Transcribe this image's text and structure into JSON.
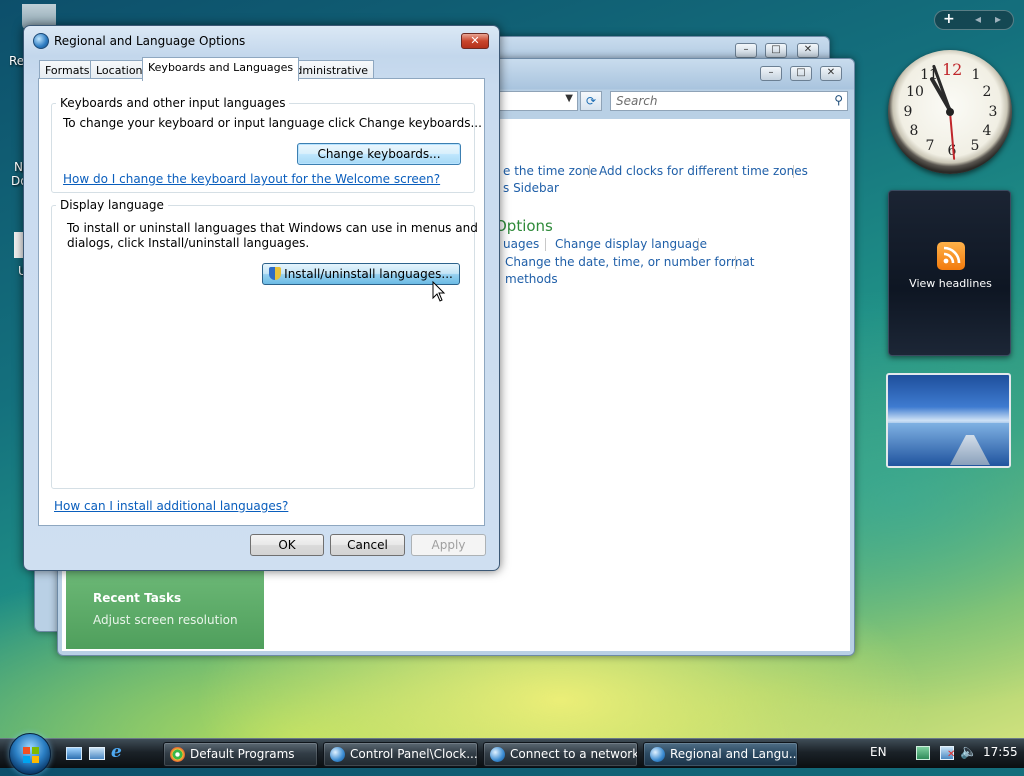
{
  "desktop": {
    "icon_fragments": [
      "Re",
      "N",
      "Do",
      "U"
    ]
  },
  "sidebar": {
    "add_symbol": "+",
    "prev_symbol": "◂",
    "next_symbol": "▸"
  },
  "clock": {
    "numerals": [
      "12",
      "1",
      "2",
      "3",
      "4",
      "5",
      "6",
      "7",
      "8",
      "9",
      "10",
      "11"
    ]
  },
  "feed_gadget": {
    "label": "View headlines"
  },
  "control_panel": {
    "search_placeholder": "Search",
    "links_row1": [
      "e the time zone",
      "Add clocks for different time zones"
    ],
    "link_row2": "s Sidebar",
    "section_heading": "Options",
    "links_row3": [
      "uages",
      "Change display language"
    ],
    "link_row4": "Change the date, time, or number format",
    "link_row5": "methods",
    "recent_tasks_title": "Recent Tasks",
    "recent_tasks_item": "Adjust screen resolution"
  },
  "dialog": {
    "title": "Regional and Language Options",
    "tabs": [
      "Formats",
      "Location",
      "Keyboards and Languages",
      "Administrative"
    ],
    "active_tab": "Keyboards and Languages",
    "keyboards_group": {
      "title": "Keyboards and other input languages",
      "description": "To change your keyboard or input language click Change keyboards...",
      "button": "Change keyboards...",
      "link": "How do I change the keyboard layout for the Welcome screen?"
    },
    "display_group": {
      "title": "Display language",
      "description_line1": "To install or uninstall languages that Windows can use in menus and",
      "description_line2": "dialogs, click Install/uninstall languages.",
      "button": "Install/uninstall languages..."
    },
    "footer_link": "How can I install additional languages?",
    "buttons": {
      "ok": "OK",
      "cancel": "Cancel",
      "apply": "Apply"
    }
  },
  "taskbar": {
    "buttons": [
      {
        "label": "Default Programs",
        "icon": "default-programs-icon"
      },
      {
        "label": "Control Panel\\Clock...",
        "icon": "control-panel-icon"
      },
      {
        "label": "Connect to a network",
        "icon": "network-icon"
      },
      {
        "label": "Regional and Langu...",
        "icon": "regional-icon",
        "active": true
      }
    ],
    "language": "EN",
    "time": "17:55"
  },
  "colors": {
    "link": "#0a5ebd",
    "cp_link": "#1f5fa8",
    "cp_heading": "#2f8a3a",
    "recent_tasks_bg": "#5aa865"
  }
}
